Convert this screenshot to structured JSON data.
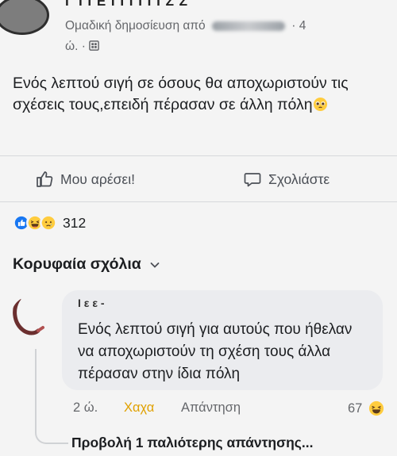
{
  "post": {
    "author": "Γ Ι Ι Ε Ι Ι Ι Ι Ι Ι Ζ Ζ",
    "meta_prefix": "Ομαδική δημοσίευση από",
    "meta_suffix": "· 4",
    "time": "ώ. ·",
    "text": "Ενός λεπτού σιγή σε όσους θα αποχωριστούν τις σχέσεις τους,επειδή πέρασαν σε άλλη πόλη"
  },
  "actions": {
    "like_label": "Μου αρέσει!",
    "comment_label": "Σχολιάστε"
  },
  "reactions": {
    "icons": [
      "like-icon",
      "haha-icon",
      "sad-icon"
    ],
    "count": "312"
  },
  "comments_section": {
    "title": "Κορυφαία σχόλια"
  },
  "comment": {
    "author": "Ι ε ε -",
    "text": "Ενός λεπτού σιγή για αυτούς που ήθελαν να αποχωριστούν τη σχέση τους άλλα πέρασαν στην ίδια πόλη",
    "time": "2 ώ.",
    "haha_label": "Χαχα",
    "reply_label": "Απάντηση",
    "reaction_count": "67"
  },
  "more_replies": "Προβολή 1 παλιότερης απάντησης..."
}
